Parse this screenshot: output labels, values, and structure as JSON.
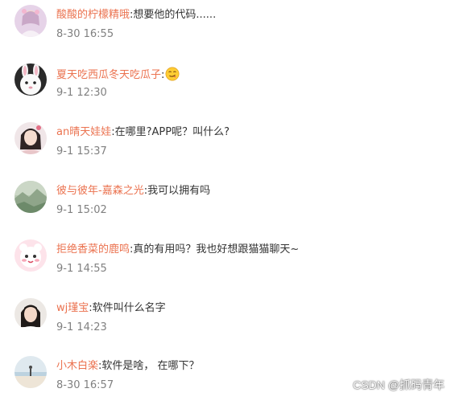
{
  "comments": [
    {
      "user": "酸酸的柠檬精哦",
      "text": "想要他的代码......",
      "time": "8-30 16:55",
      "avatar": "avatar-girl-pink"
    },
    {
      "user": "夏天吃西瓜冬天吃瓜子",
      "text": "",
      "time": "9-1 12:30",
      "avatar": "avatar-white-rabbit",
      "emoji": "smirk-emoji-icon"
    },
    {
      "user": "an晴天娃娃",
      "text": "在哪里?APP呢？叫什么?",
      "time": "9-1 15:37",
      "avatar": "avatar-girl-portrait"
    },
    {
      "user": "彼与彼年-嘉森之光",
      "text": "我可以拥有吗",
      "time": "9-1 15:02",
      "avatar": "avatar-landscape"
    },
    {
      "user": "拒绝香菜的鹿鸣",
      "text": "真的有用吗？我也好想跟猫猫聊天~",
      "time": "9-1 14:55",
      "avatar": "avatar-cartoon"
    },
    {
      "user": "wj瑾宝",
      "text": "软件叫什么名字",
      "time": "9-1 14:23",
      "avatar": "avatar-girl-dark-hair"
    },
    {
      "user": "小木白楽",
      "text": "软件是啥， 在哪下？",
      "time": "8-30 16:57",
      "avatar": "avatar-beach"
    }
  ],
  "separator": ":",
  "watermark": "CSDN @抓码青年",
  "colors": {
    "username": "#eb7350",
    "text": "#333333",
    "time": "#808080"
  }
}
